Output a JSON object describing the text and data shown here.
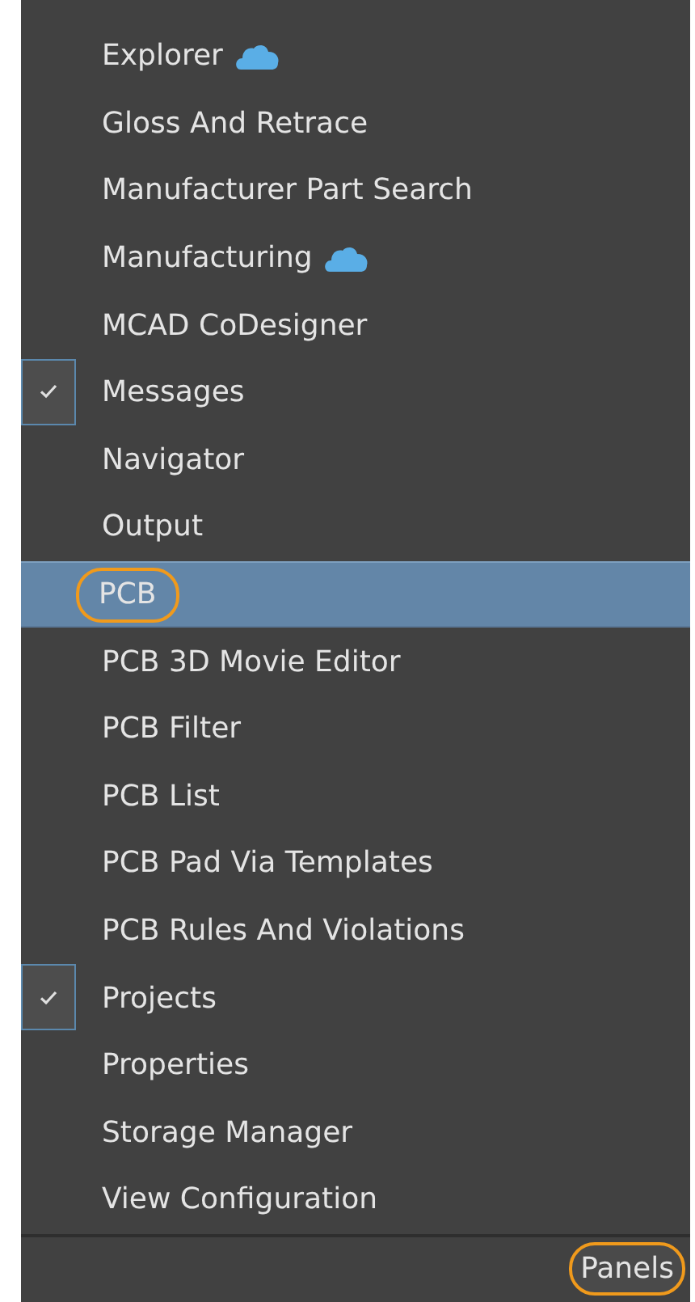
{
  "menu": {
    "items": [
      {
        "label": "Explorer",
        "checked": false,
        "selected": false,
        "cloud": true,
        "circled": false
      },
      {
        "label": "Gloss And Retrace",
        "checked": false,
        "selected": false,
        "cloud": false,
        "circled": false
      },
      {
        "label": "Manufacturer Part Search",
        "checked": false,
        "selected": false,
        "cloud": false,
        "circled": false
      },
      {
        "label": "Manufacturing",
        "checked": false,
        "selected": false,
        "cloud": true,
        "circled": false
      },
      {
        "label": "MCAD CoDesigner",
        "checked": false,
        "selected": false,
        "cloud": false,
        "circled": false
      },
      {
        "label": "Messages",
        "checked": true,
        "selected": false,
        "cloud": false,
        "circled": false
      },
      {
        "label": "Navigator",
        "checked": false,
        "selected": false,
        "cloud": false,
        "circled": false
      },
      {
        "label": "Output",
        "checked": false,
        "selected": false,
        "cloud": false,
        "circled": false
      },
      {
        "label": "PCB",
        "checked": false,
        "selected": true,
        "cloud": false,
        "circled": true
      },
      {
        "label": "PCB 3D Movie Editor",
        "checked": false,
        "selected": false,
        "cloud": false,
        "circled": false
      },
      {
        "label": "PCB Filter",
        "checked": false,
        "selected": false,
        "cloud": false,
        "circled": false
      },
      {
        "label": "PCB List",
        "checked": false,
        "selected": false,
        "cloud": false,
        "circled": false
      },
      {
        "label": "PCB Pad Via Templates",
        "checked": false,
        "selected": false,
        "cloud": false,
        "circled": false
      },
      {
        "label": "PCB Rules And Violations",
        "checked": false,
        "selected": false,
        "cloud": false,
        "circled": false
      },
      {
        "label": "Projects",
        "checked": true,
        "selected": false,
        "cloud": false,
        "circled": false
      },
      {
        "label": "Properties",
        "checked": false,
        "selected": false,
        "cloud": false,
        "circled": false
      },
      {
        "label": "Storage Manager",
        "checked": false,
        "selected": false,
        "cloud": false,
        "circled": false
      },
      {
        "label": "View Configuration",
        "checked": false,
        "selected": false,
        "cloud": false,
        "circled": false
      }
    ]
  },
  "status_bar": {
    "button": {
      "label": "Panels",
      "circled": true
    }
  }
}
